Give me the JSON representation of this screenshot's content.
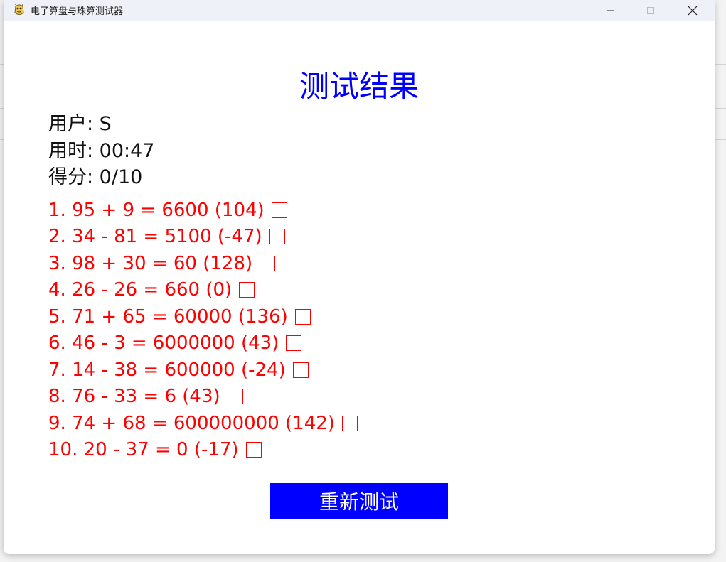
{
  "window": {
    "title": "电子算盘与珠算测试器"
  },
  "result": {
    "title": "测试结果",
    "user_line": "用户: S",
    "time_line": "用时: 00:47",
    "score_line": "得分: 0/10"
  },
  "questions": [
    "1. 95 + 9 = 6600 (104)",
    "2. 34 - 81 = 5100 (-47)",
    "3. 98 + 30 = 60 (128)",
    "4. 26 - 26 = 660 (0)",
    "5. 71 + 65 = 60000 (136)",
    "6. 46 - 3 = 6000000 (43)",
    "7. 14 - 38 = 600000 (-24)",
    "8. 76 - 33 = 6 (43)",
    "9. 74 + 68 = 600000000 (142)",
    "10. 20 - 37 = 0 (-17)"
  ],
  "actions": {
    "retry_label": "重新测试"
  },
  "colors": {
    "title": "#0000ff",
    "wrong": "#ff0000",
    "button_bg": "#0000ff",
    "button_text": "#ffffff"
  }
}
